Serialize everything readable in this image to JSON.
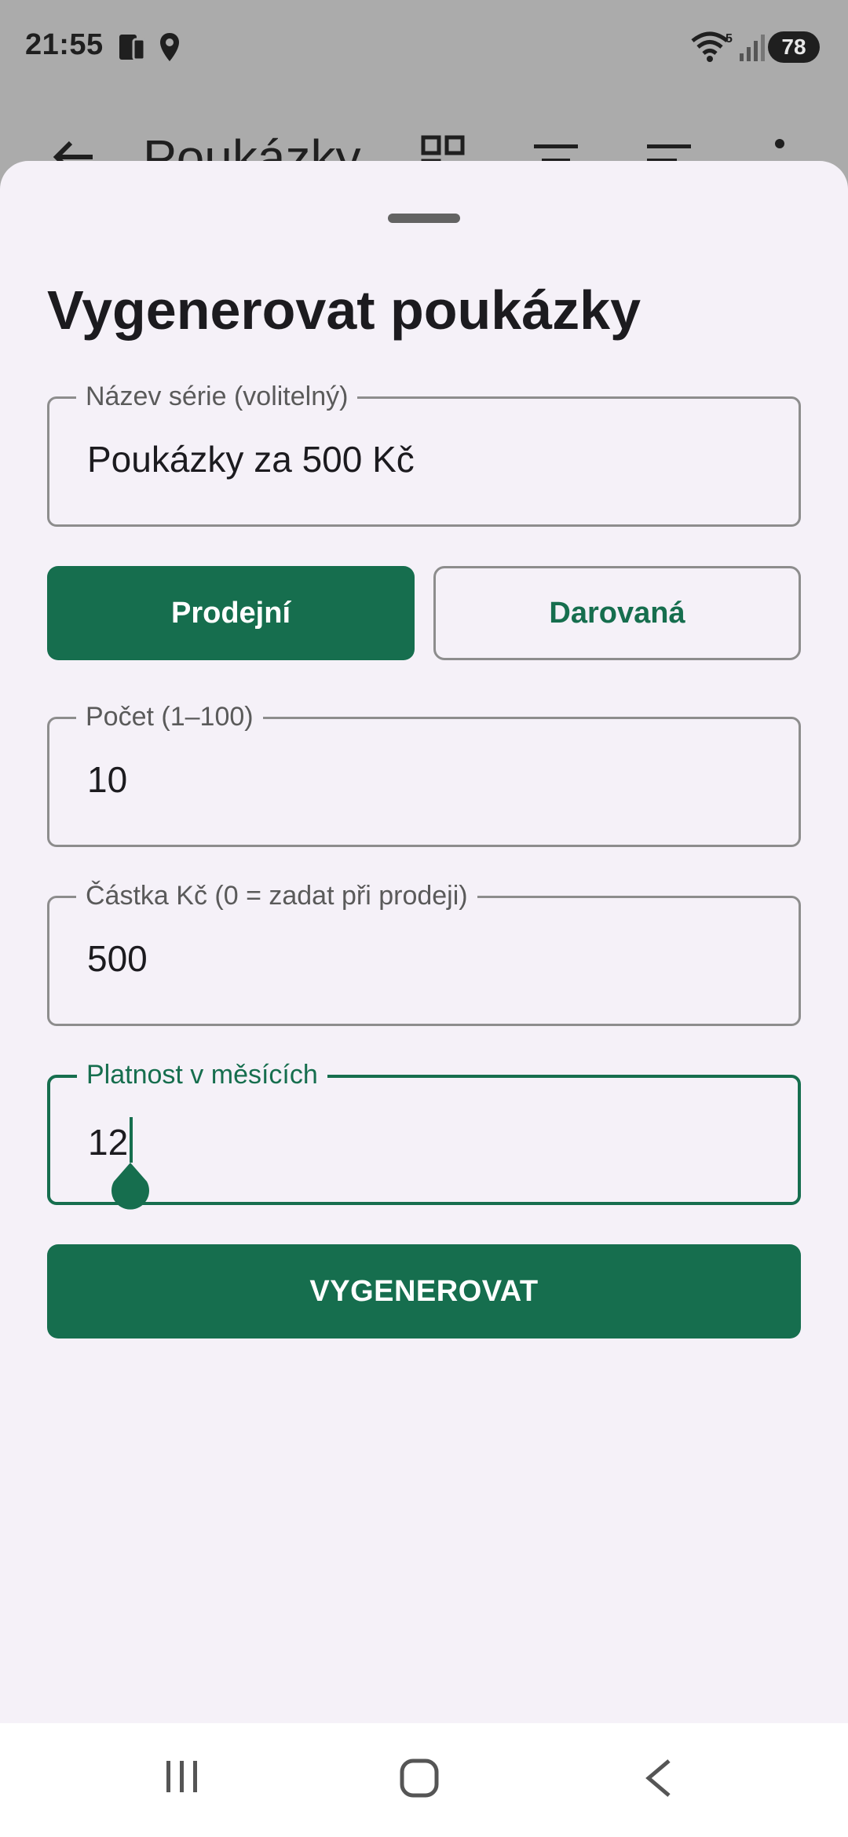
{
  "status_bar": {
    "time": "21:55",
    "battery": "78",
    "wifi_label": "5"
  },
  "app_bar": {
    "title": "Poukázky"
  },
  "sheet": {
    "title": "Vygenerovat poukázky",
    "fields": {
      "series_name": {
        "label": "Název série (volitelný)",
        "value": "Poukázky za 500 Kč"
      },
      "count": {
        "label": "Počet (1–100)",
        "value": "10"
      },
      "amount": {
        "label": "Částka Kč (0 = zadat při prodeji)",
        "value": "500"
      },
      "validity": {
        "label": "Platnost v měsících",
        "value": "12"
      }
    },
    "type_toggle": {
      "selected_label": "Prodejní",
      "unselected_label": "Darovaná"
    },
    "generate_label": "VYGENEROVAT"
  },
  "colors": {
    "accent": "#166e4e",
    "sheet_background": "#f5f1f8",
    "scrim": "#ababab"
  },
  "icons": [
    "nfc-phone-icon",
    "location-icon",
    "wifi-icon",
    "signal-icon",
    "back-arrow-icon",
    "qr-code-icon",
    "filter-icon",
    "sort-icon",
    "more-vert-icon",
    "recents-icon",
    "home-icon",
    "back-icon"
  ]
}
